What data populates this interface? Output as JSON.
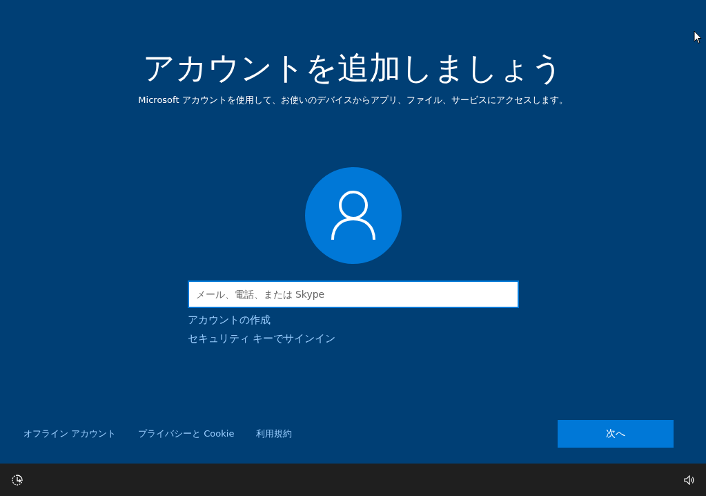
{
  "title": "アカウントを追加しましょう",
  "subtitle": "Microsoft アカウントを使用して、お使いのデバイスからアプリ、ファイル、サービスにアクセスします。",
  "signin_field": {
    "placeholder": "メール、電話、または Skype"
  },
  "links": [
    "アカウントの作成",
    "セキュリティ キーでサインイン"
  ],
  "footer_links": [
    "オフライン アカウント",
    "プライバシーと Cookie",
    "利用規約"
  ],
  "next_button": "次へ"
}
